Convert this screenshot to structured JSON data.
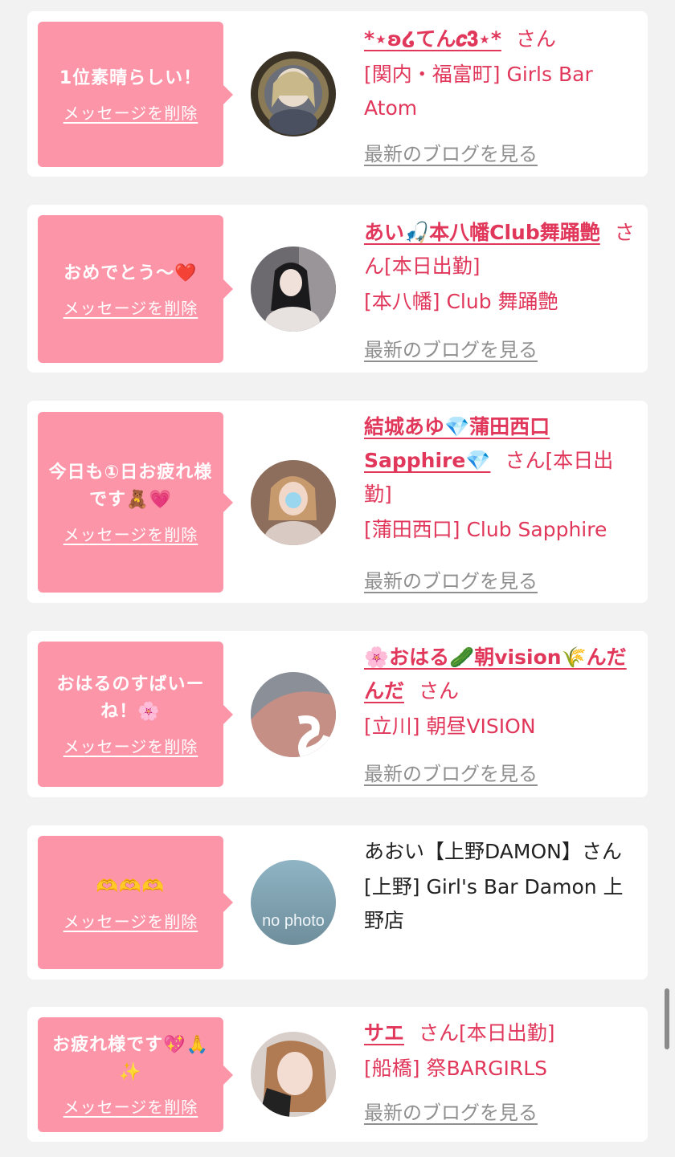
{
  "colors": {
    "accent": "#e0375b",
    "bubble": "#fd95a8",
    "link_gray": "#8f8f8f"
  },
  "delete_label": "メッセージを削除",
  "blog_label": "最新のブログを見る",
  "entries": [
    {
      "message": "1位素晴らしい！",
      "name": "*⋆ʚ໒てん𝒄𝟑⋆*",
      "san": "さん",
      "shop": "[関内・福富町] Girls Bar Atom",
      "blog": "最新のブログを見る"
    },
    {
      "message": "おめでとう〜❤️",
      "name": "あい🎣本八幡Club舞踊艶",
      "san": "さん[本日出勤]",
      "shop": "[本八幡] Club 舞踊艶",
      "blog": "最新のブログを見る"
    },
    {
      "message": "今日も①日お疲れ様です🧸💗",
      "name": "結城あゆ💎蒲田西口Sapphire💎",
      "san": "さん[本日出勤]",
      "shop": "[蒲田西口] Club Sapphire",
      "blog": "最新のブログを見る"
    },
    {
      "message": "おはるのすばいーね！🌸",
      "name": "🌸おはる🥒朝vision🌾んだんだ",
      "san": "さん",
      "shop": "[立川] 朝昼VISION",
      "blog": "最新のブログを見る"
    },
    {
      "message": "🫶🫶🫶",
      "name": "あおい【上野DAMON】さん",
      "shop": "[上野] Girl's Bar Damon 上野店",
      "avatar_text": "no photo"
    },
    {
      "message": "お疲れ様です💖🙏✨",
      "name": "サエ",
      "san": "さん[本日出勤]",
      "shop": "[船橋] 祭BARGIRLS",
      "blog": "最新のブログを見る"
    }
  ]
}
